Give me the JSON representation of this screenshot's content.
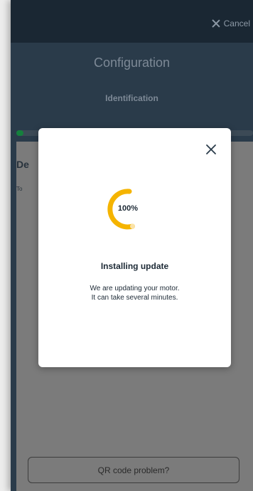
{
  "topbar": {
    "cancel_label": "Cancel",
    "cancel_icon": "close-icon"
  },
  "header": {
    "title": "Configuration",
    "step": "Identification"
  },
  "progress": {
    "fraction": 0.03,
    "color": "#15803d"
  },
  "content": {
    "heading": "De",
    "text": "To",
    "qr_button_label": "QR code problem?"
  },
  "modal": {
    "close_icon": "close-icon",
    "percent_label": "100%",
    "title": "Installing update",
    "line1": "We are updating your motor.",
    "line2": "It can take several minutes.",
    "accent_color": "#f5b400"
  }
}
